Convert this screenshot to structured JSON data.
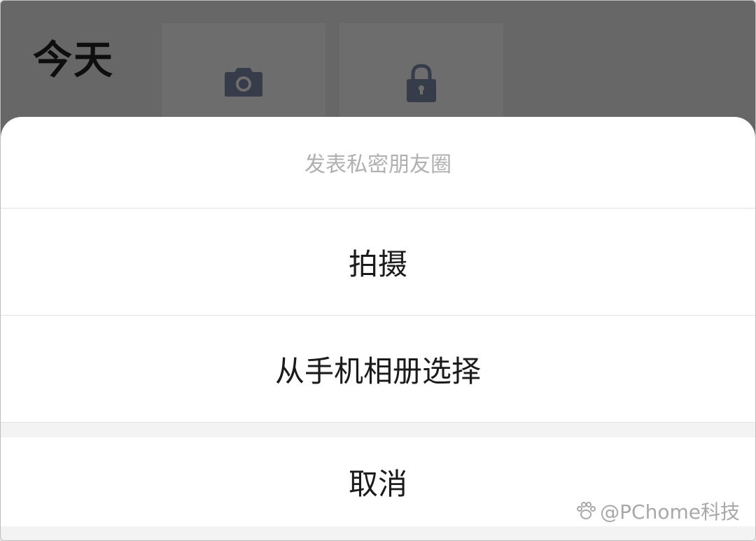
{
  "background": {
    "title": "今天",
    "tiles": [
      {
        "icon": "camera-icon"
      },
      {
        "icon": "lock-icon"
      }
    ]
  },
  "action_sheet": {
    "title": "发表私密朋友圈",
    "options": [
      {
        "label": "拍摄"
      },
      {
        "label": "从手机相册选择"
      }
    ],
    "cancel_label": "取消"
  },
  "watermark": {
    "text": "@PChome科技"
  },
  "colors": {
    "overlay": "#676767",
    "sheet": "#ffffff",
    "title_text": "#b0b0b0",
    "option_text": "#1b1b1b",
    "icon": "#363c4a"
  }
}
